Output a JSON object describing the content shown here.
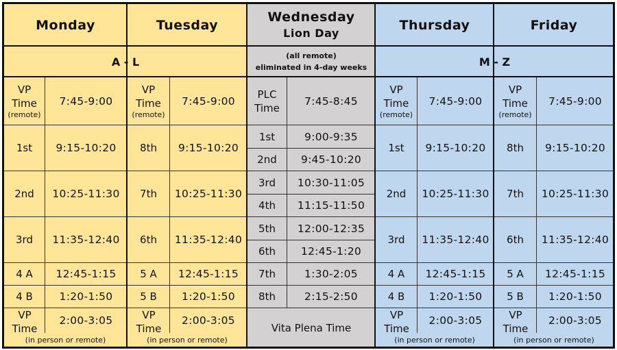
{
  "days": [
    {
      "name": "Monday"
    },
    {
      "name": "Tuesday"
    },
    {
      "name": "Wednesday",
      "subtitle": "Lion Day"
    },
    {
      "name": "Thursday"
    },
    {
      "name": "Friday"
    }
  ],
  "groups": {
    "a_l": "A - L",
    "wednesday_note_1": "(all remote)",
    "wednesday_note_2": "eliminated in 4-day weeks",
    "m_z": "M - Z"
  },
  "vp": {
    "label_1": "VP",
    "label_2": "Time",
    "morning_note": "(remote)",
    "afternoon_note": "(in person or remote)"
  },
  "colors": {
    "a_l": "#fee598",
    "wednesday": "#d3d1d1",
    "m_z": "#bed7ee"
  },
  "schedule": {
    "monday": [
      {
        "time": "7:45-9:00"
      },
      {
        "period": "1st",
        "time": "9:15-10:20"
      },
      {
        "period": "2nd",
        "time": "10:25-11:30"
      },
      {
        "period": "3rd",
        "time": "11:35-12:40"
      },
      {
        "period": "4 A",
        "time": "12:45-1:15"
      },
      {
        "period": "4 B",
        "time": "1:20-1:50"
      },
      {
        "time": "2:00-3:05"
      }
    ],
    "tuesday": [
      {
        "time": "7:45-9:00"
      },
      {
        "period": "8th",
        "time": "9:15-10:20"
      },
      {
        "period": "7th",
        "time": "10:25-11:30"
      },
      {
        "period": "6th",
        "time": "11:35-12:40"
      },
      {
        "period": "5 A",
        "time": "12:45-1:15"
      },
      {
        "period": "5 B",
        "time": "1:20-1:50"
      },
      {
        "time": "2:00-3:05"
      }
    ],
    "wednesday": [
      {
        "period": "PLC Time",
        "time": "7:45-8:45"
      },
      {
        "period": "1st",
        "time": "9:00-9:35"
      },
      {
        "period": "2nd",
        "time": "9:45-10:20"
      },
      {
        "period": "3rd",
        "time": "10:30-11:05"
      },
      {
        "period": "4th",
        "time": "11:15-11:50"
      },
      {
        "period": "5th",
        "time": "12:00-12:35"
      },
      {
        "period": "6th",
        "time": "12:45-1:20"
      },
      {
        "period": "7th",
        "time": "1:30-2:05"
      },
      {
        "period": "8th",
        "time": "2:15-2:50"
      },
      {
        "period": "Vita Plena Time"
      }
    ],
    "thursday": [
      {
        "time": "7:45-9:00"
      },
      {
        "period": "1st",
        "time": "9:15-10:20"
      },
      {
        "period": "2nd",
        "time": "10:25-11:30"
      },
      {
        "period": "3rd",
        "time": "11:35-12:40"
      },
      {
        "period": "4 A",
        "time": "12:45-1:15"
      },
      {
        "period": "4 B",
        "time": "1:20-1:50"
      },
      {
        "time": "2:00-3:05"
      }
    ],
    "friday": [
      {
        "time": "7:45-9:00"
      },
      {
        "period": "8th",
        "time": "9:15-10:20"
      },
      {
        "period": "7th",
        "time": "10:25-11:30"
      },
      {
        "period": "6th",
        "time": "11:35-12:40"
      },
      {
        "period": "5 A",
        "time": "12:45-1:15"
      },
      {
        "period": "5 B",
        "time": "1:20-1:50"
      },
      {
        "time": "2:00-3:05"
      }
    ]
  }
}
